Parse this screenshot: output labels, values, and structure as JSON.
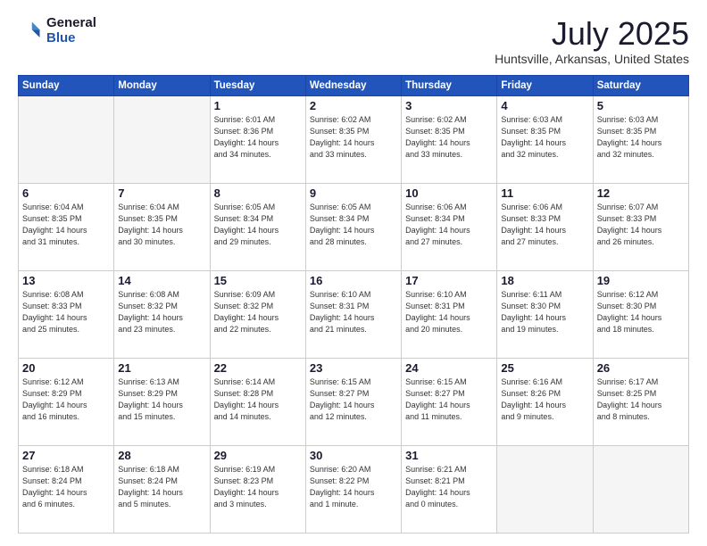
{
  "logo": {
    "general": "General",
    "blue": "Blue"
  },
  "title": {
    "month": "July 2025",
    "location": "Huntsville, Arkansas, United States"
  },
  "calendar": {
    "headers": [
      "Sunday",
      "Monday",
      "Tuesday",
      "Wednesday",
      "Thursday",
      "Friday",
      "Saturday"
    ],
    "rows": [
      [
        {
          "day": "",
          "info": ""
        },
        {
          "day": "",
          "info": ""
        },
        {
          "day": "1",
          "info": "Sunrise: 6:01 AM\nSunset: 8:36 PM\nDaylight: 14 hours\nand 34 minutes."
        },
        {
          "day": "2",
          "info": "Sunrise: 6:02 AM\nSunset: 8:35 PM\nDaylight: 14 hours\nand 33 minutes."
        },
        {
          "day": "3",
          "info": "Sunrise: 6:02 AM\nSunset: 8:35 PM\nDaylight: 14 hours\nand 33 minutes."
        },
        {
          "day": "4",
          "info": "Sunrise: 6:03 AM\nSunset: 8:35 PM\nDaylight: 14 hours\nand 32 minutes."
        },
        {
          "day": "5",
          "info": "Sunrise: 6:03 AM\nSunset: 8:35 PM\nDaylight: 14 hours\nand 32 minutes."
        }
      ],
      [
        {
          "day": "6",
          "info": "Sunrise: 6:04 AM\nSunset: 8:35 PM\nDaylight: 14 hours\nand 31 minutes."
        },
        {
          "day": "7",
          "info": "Sunrise: 6:04 AM\nSunset: 8:35 PM\nDaylight: 14 hours\nand 30 minutes."
        },
        {
          "day": "8",
          "info": "Sunrise: 6:05 AM\nSunset: 8:34 PM\nDaylight: 14 hours\nand 29 minutes."
        },
        {
          "day": "9",
          "info": "Sunrise: 6:05 AM\nSunset: 8:34 PM\nDaylight: 14 hours\nand 28 minutes."
        },
        {
          "day": "10",
          "info": "Sunrise: 6:06 AM\nSunset: 8:34 PM\nDaylight: 14 hours\nand 27 minutes."
        },
        {
          "day": "11",
          "info": "Sunrise: 6:06 AM\nSunset: 8:33 PM\nDaylight: 14 hours\nand 27 minutes."
        },
        {
          "day": "12",
          "info": "Sunrise: 6:07 AM\nSunset: 8:33 PM\nDaylight: 14 hours\nand 26 minutes."
        }
      ],
      [
        {
          "day": "13",
          "info": "Sunrise: 6:08 AM\nSunset: 8:33 PM\nDaylight: 14 hours\nand 25 minutes."
        },
        {
          "day": "14",
          "info": "Sunrise: 6:08 AM\nSunset: 8:32 PM\nDaylight: 14 hours\nand 23 minutes."
        },
        {
          "day": "15",
          "info": "Sunrise: 6:09 AM\nSunset: 8:32 PM\nDaylight: 14 hours\nand 22 minutes."
        },
        {
          "day": "16",
          "info": "Sunrise: 6:10 AM\nSunset: 8:31 PM\nDaylight: 14 hours\nand 21 minutes."
        },
        {
          "day": "17",
          "info": "Sunrise: 6:10 AM\nSunset: 8:31 PM\nDaylight: 14 hours\nand 20 minutes."
        },
        {
          "day": "18",
          "info": "Sunrise: 6:11 AM\nSunset: 8:30 PM\nDaylight: 14 hours\nand 19 minutes."
        },
        {
          "day": "19",
          "info": "Sunrise: 6:12 AM\nSunset: 8:30 PM\nDaylight: 14 hours\nand 18 minutes."
        }
      ],
      [
        {
          "day": "20",
          "info": "Sunrise: 6:12 AM\nSunset: 8:29 PM\nDaylight: 14 hours\nand 16 minutes."
        },
        {
          "day": "21",
          "info": "Sunrise: 6:13 AM\nSunset: 8:29 PM\nDaylight: 14 hours\nand 15 minutes."
        },
        {
          "day": "22",
          "info": "Sunrise: 6:14 AM\nSunset: 8:28 PM\nDaylight: 14 hours\nand 14 minutes."
        },
        {
          "day": "23",
          "info": "Sunrise: 6:15 AM\nSunset: 8:27 PM\nDaylight: 14 hours\nand 12 minutes."
        },
        {
          "day": "24",
          "info": "Sunrise: 6:15 AM\nSunset: 8:27 PM\nDaylight: 14 hours\nand 11 minutes."
        },
        {
          "day": "25",
          "info": "Sunrise: 6:16 AM\nSunset: 8:26 PM\nDaylight: 14 hours\nand 9 minutes."
        },
        {
          "day": "26",
          "info": "Sunrise: 6:17 AM\nSunset: 8:25 PM\nDaylight: 14 hours\nand 8 minutes."
        }
      ],
      [
        {
          "day": "27",
          "info": "Sunrise: 6:18 AM\nSunset: 8:24 PM\nDaylight: 14 hours\nand 6 minutes."
        },
        {
          "day": "28",
          "info": "Sunrise: 6:18 AM\nSunset: 8:24 PM\nDaylight: 14 hours\nand 5 minutes."
        },
        {
          "day": "29",
          "info": "Sunrise: 6:19 AM\nSunset: 8:23 PM\nDaylight: 14 hours\nand 3 minutes."
        },
        {
          "day": "30",
          "info": "Sunrise: 6:20 AM\nSunset: 8:22 PM\nDaylight: 14 hours\nand 1 minute."
        },
        {
          "day": "31",
          "info": "Sunrise: 6:21 AM\nSunset: 8:21 PM\nDaylight: 14 hours\nand 0 minutes."
        },
        {
          "day": "",
          "info": ""
        },
        {
          "day": "",
          "info": ""
        }
      ]
    ]
  }
}
